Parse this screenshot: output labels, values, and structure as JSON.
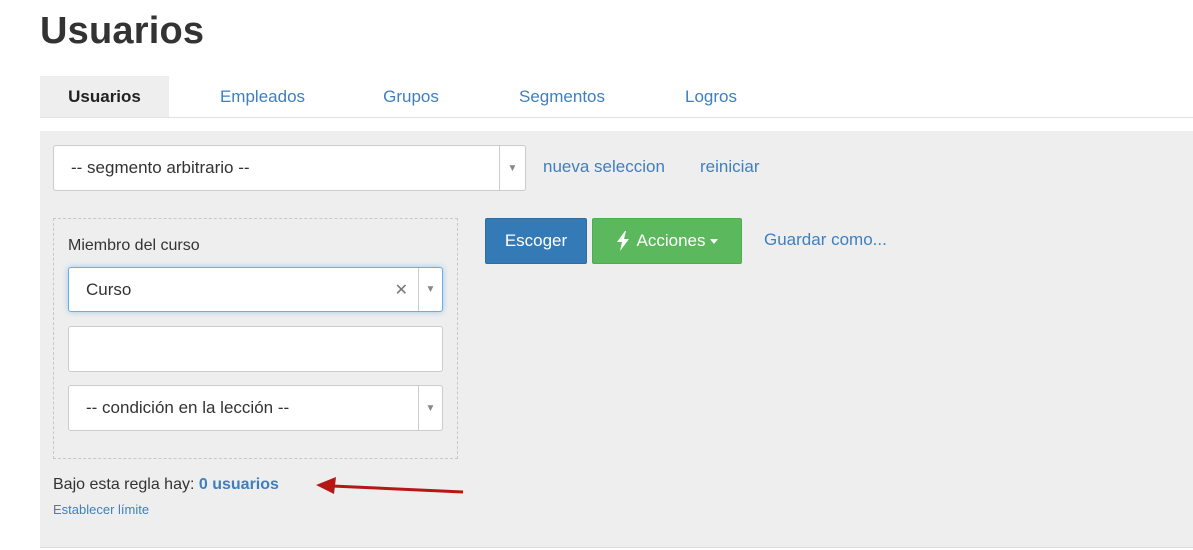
{
  "page": {
    "title": "Usuarios"
  },
  "tabs": [
    {
      "label": "Usuarios",
      "active": true
    },
    {
      "label": "Empleados",
      "active": false
    },
    {
      "label": "Grupos",
      "active": false
    },
    {
      "label": "Segmentos",
      "active": false
    },
    {
      "label": "Logros",
      "active": false
    }
  ],
  "segment": {
    "selected": "-- segmento arbitrario --",
    "new_selection_link": "nueva seleccion",
    "reset_link": "reiniciar"
  },
  "rule": {
    "label": "Miembro del curso",
    "course_select": "Curso",
    "text_input_value": "",
    "lesson_condition_select": "-- condición en la lección --"
  },
  "actions": {
    "choose_label": "Escoger",
    "actions_label": "Acciones",
    "save_as_label": "Guardar como..."
  },
  "summary": {
    "prefix": "Bajo esta regla hay:",
    "count_label": "0 usuarios",
    "limit_link": "Establecer límite"
  },
  "colors": {
    "link": "#3f7fbf",
    "primary": "#337ab7",
    "success": "#5cb85c",
    "panel": "#eeeeee",
    "annotation_arrow": "#b51717"
  },
  "icons": {
    "select_arrow": "triangle-down",
    "clear": "x",
    "actions": "lightning-bolt",
    "annotation": "red-arrow-left"
  }
}
